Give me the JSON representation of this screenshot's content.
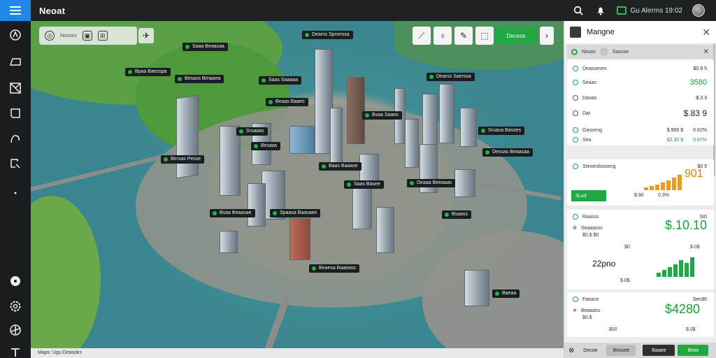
{
  "app": {
    "title": "Neoat"
  },
  "header": {
    "status_text": "Gu Alerms 19:02"
  },
  "map": {
    "toolbar_text": "Nooses",
    "primary_button": "Decess",
    "footer_text": "Maps: Ugu Deasoks",
    "labels": [
      "Dearss Spnerssa",
      "Saaa Beaasaa",
      "Bpaa Baesspa",
      "Besass Brnaaea",
      "Saas Saaaaa",
      "Dearss Saerssa",
      "Beaas Baaes",
      "Bsaa Saaes",
      "Sruaca Basses",
      "Srsaaas",
      "Besaas",
      "Dessas Beaasaa",
      "Bersas Pesse",
      "Baas Baaase",
      "Saas Basee",
      "Deaaa Beeaaas",
      "Bsaa Beaasae",
      "Spaasa Baasaee",
      "Bsaass",
      "Beaesa Baaeass",
      "Baeaa"
    ]
  },
  "panel": {
    "title": "Mangne",
    "search": {
      "left": "Nouss",
      "right": "Saosse"
    },
    "summary": [
      {
        "label": "Deasseses",
        "value": "$0.9 5"
      },
      {
        "label": "Seaas",
        "value": "3580"
      },
      {
        "label": "Daoas",
        "value": "$.3 3"
      },
      {
        "label": "Dat",
        "value": "$.83 9"
      }
    ],
    "totals": [
      {
        "label": "Gasseng",
        "a": "$.900 $",
        "b": "0.82%"
      },
      {
        "label": "Sea",
        "a": "$2.30 $",
        "b": "0.87%"
      }
    ],
    "chart_card": {
      "title": "Stenerdooseng",
      "value": "$0 9",
      "big": "901",
      "bar_label": "3Lud",
      "b1": "$.90",
      "b2": "0.3%"
    },
    "card2": {
      "title": "Raasss",
      "top": "SI0",
      "sub1": "Seaaasss",
      "sub2": "$0.$ $0",
      "big": "$.10.10",
      "mid_label": "22pno",
      "small_a": "$0",
      "small_b": "$.0$",
      "small_c": "$.0$"
    },
    "card3": {
      "title": "Faeace",
      "top": "Sen90",
      "sub1": "Beaaass",
      "sub2": "$0.$",
      "big": "$4280",
      "small_a": "$00",
      "small_b": "$.0$"
    },
    "bottom": {
      "b1": "Decoe",
      "b2": "Bessee",
      "b3": "Baaee",
      "b4": "Bese"
    }
  }
}
